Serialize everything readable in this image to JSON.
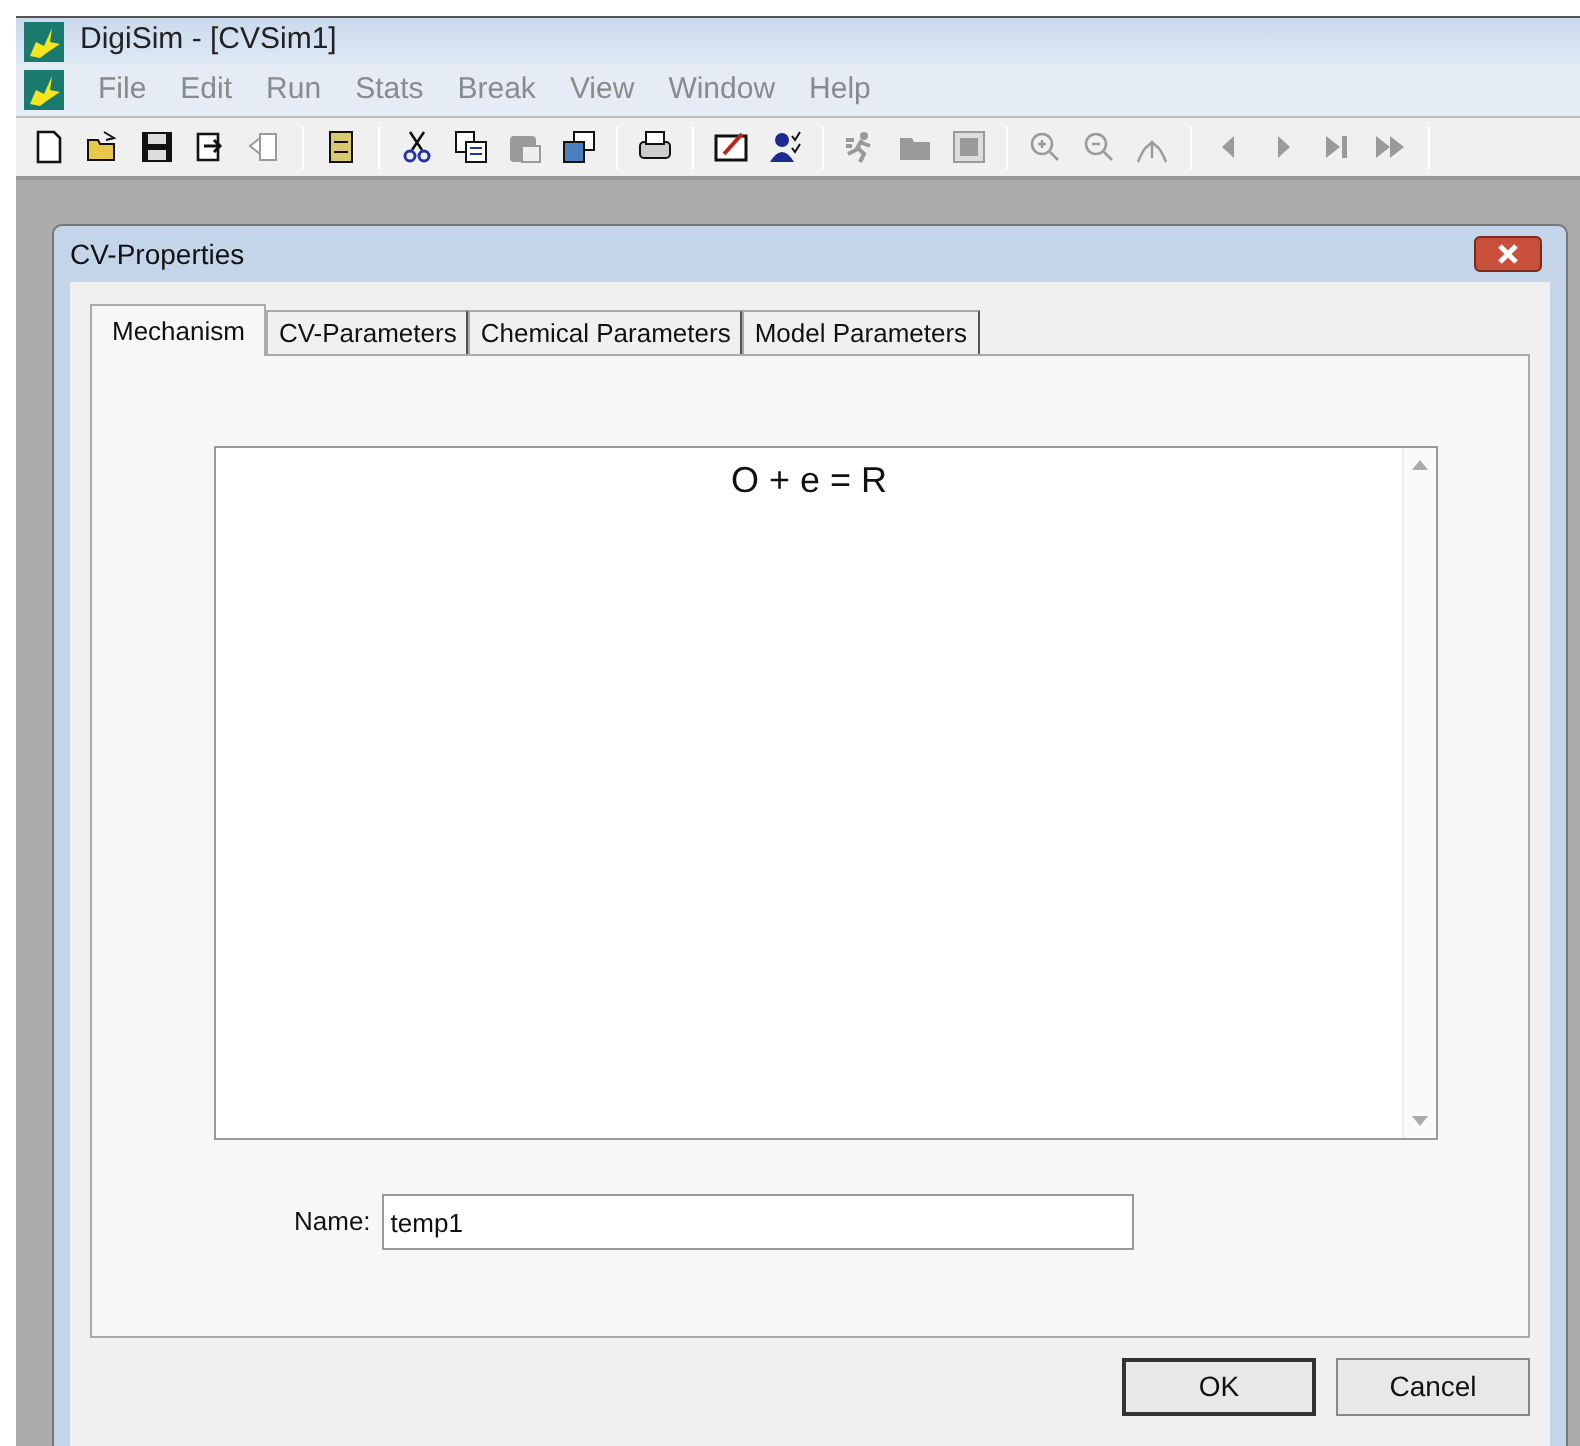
{
  "window": {
    "title": "DigiSim - [CVSim1]"
  },
  "menu": [
    {
      "label": "File",
      "disabled": true
    },
    {
      "label": "Edit",
      "disabled": true
    },
    {
      "label": "Run",
      "disabled": true
    },
    {
      "label": "Stats",
      "disabled": true
    },
    {
      "label": "Break",
      "disabled": true
    },
    {
      "label": "View",
      "disabled": true
    },
    {
      "label": "Window",
      "disabled": true
    },
    {
      "label": "Help",
      "disabled": true
    }
  ],
  "toolbar": [
    {
      "kind": "new",
      "disabled": false
    },
    {
      "kind": "open",
      "disabled": false
    },
    {
      "kind": "save",
      "disabled": false
    },
    {
      "kind": "export",
      "disabled": false
    },
    {
      "kind": "import",
      "disabled": true
    },
    {
      "kind": "separator"
    },
    {
      "kind": "cabinet",
      "disabled": false
    },
    {
      "kind": "separator"
    },
    {
      "kind": "cut",
      "disabled": false
    },
    {
      "kind": "copy",
      "disabled": false
    },
    {
      "kind": "paste",
      "disabled": true
    },
    {
      "kind": "windows",
      "disabled": false
    },
    {
      "kind": "separator"
    },
    {
      "kind": "print",
      "disabled": false
    },
    {
      "kind": "separator"
    },
    {
      "kind": "edit",
      "disabled": false
    },
    {
      "kind": "user",
      "disabled": false
    },
    {
      "kind": "separator"
    },
    {
      "kind": "run",
      "disabled": true
    },
    {
      "kind": "folder",
      "disabled": true
    },
    {
      "kind": "grid",
      "disabled": true
    },
    {
      "kind": "separator"
    },
    {
      "kind": "zoomin",
      "disabled": true
    },
    {
      "kind": "zoomout",
      "disabled": true
    },
    {
      "kind": "arc",
      "disabled": true
    },
    {
      "kind": "separator"
    },
    {
      "kind": "prev",
      "disabled": true
    },
    {
      "kind": "next",
      "disabled": true
    },
    {
      "kind": "last",
      "disabled": true
    },
    {
      "kind": "fastforward",
      "disabled": true
    },
    {
      "kind": "separator"
    }
  ],
  "dialog": {
    "title": "CV-Properties",
    "tabs": [
      {
        "label": "Mechanism",
        "selected": true
      },
      {
        "label": "CV-Parameters",
        "selected": false
      },
      {
        "label": "Chemical Parameters",
        "selected": false
      },
      {
        "label": "Model Parameters",
        "selected": false
      }
    ],
    "mechanism_text": "O + e = R",
    "name_label": "Name:",
    "name_value": "temp1",
    "buttons": [
      "OK",
      "Cancel"
    ]
  }
}
